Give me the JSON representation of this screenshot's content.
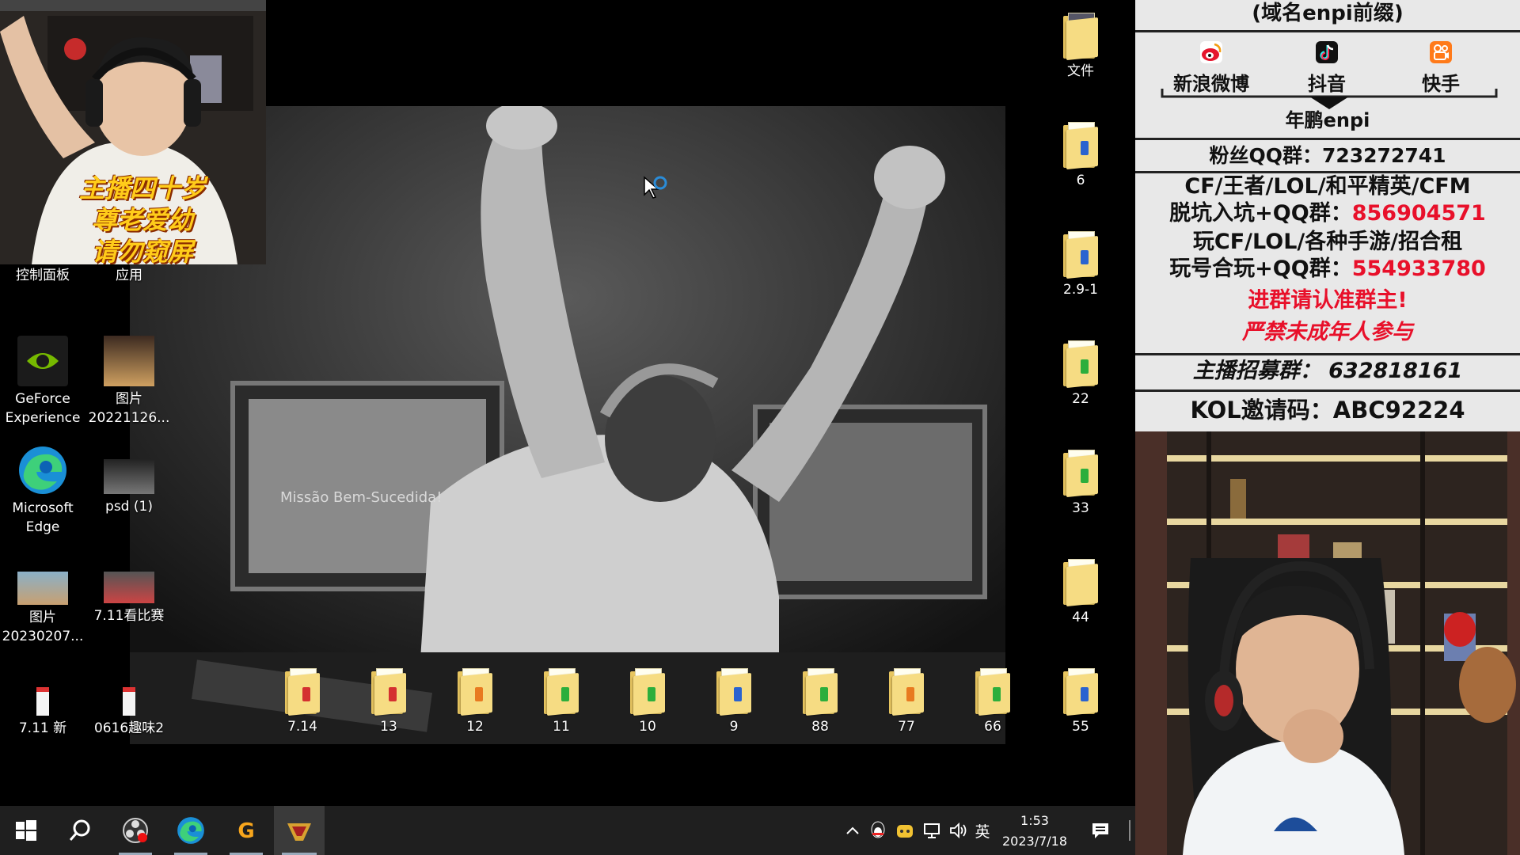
{
  "desktop": {
    "left_icons": [
      {
        "label": "控制面板"
      },
      {
        "label": "应用"
      },
      {
        "label": "GeForce Experience"
      },
      {
        "label": "图片 20221126..."
      },
      {
        "label": "Microsoft Edge"
      },
      {
        "label": "psd (1)"
      },
      {
        "label": "图片 20230207..."
      },
      {
        "label": "7.11看比赛"
      },
      {
        "label": "7.11 新"
      },
      {
        "label": "0616趣味2"
      }
    ],
    "right_folders": [
      {
        "label": "文件"
      },
      {
        "label": "6"
      },
      {
        "label": "2.9-1"
      },
      {
        "label": "22"
      },
      {
        "label": "33"
      },
      {
        "label": "44"
      },
      {
        "label": "55"
      }
    ],
    "bottom_folders": [
      {
        "label": "7.14"
      },
      {
        "label": "13"
      },
      {
        "label": "12"
      },
      {
        "label": "11"
      },
      {
        "label": "10"
      },
      {
        "label": "9"
      },
      {
        "label": "88"
      },
      {
        "label": "77"
      },
      {
        "label": "66"
      }
    ],
    "wallpaper_text": "Missão Bem-Sucedida!"
  },
  "webcam_top": {
    "caption_lines": [
      "主播四十岁",
      "尊老爱幼",
      "请勿窥屏"
    ]
  },
  "taskbar": {
    "input_method": "英",
    "clock_time": "1:53",
    "clock_date": "2023/7/18",
    "icons": [
      "windows-start-icon",
      "search-icon",
      "obs-icon",
      "edge-icon",
      "game-g-icon",
      "crossfire-icon"
    ]
  },
  "panel": {
    "domain_line": "(域名enpi前缀)",
    "social": [
      {
        "label": "新浪微博",
        "icon": "weibo-icon",
        "color": "#e6162d"
      },
      {
        "label": "抖音",
        "icon": "douyin-icon",
        "color": "#111111"
      },
      {
        "label": "快手",
        "icon": "kuaishou-icon",
        "color": "#ff7a1a"
      }
    ],
    "account": "年鹏enpi",
    "fan_qq": "粉丝QQ群：723272741",
    "line_games": "CF/王者/LOL/和平精英/CFM",
    "line_qq1_prefix": "脱坑入坑+QQ群：",
    "line_qq1_num": "856904571",
    "line_games2": "玩CF/LOL/各种手游/招合租",
    "line_qq2_prefix": "玩号合玩+QQ群：",
    "line_qq2_num": "554933780",
    "notice1": "进群请认准群主!",
    "notice2": "严禁未成年人参与",
    "recruit": "主播招募群：  632818161",
    "kol": "KOL邀请码：ABC92224",
    "accent_red": "#e8102a"
  }
}
